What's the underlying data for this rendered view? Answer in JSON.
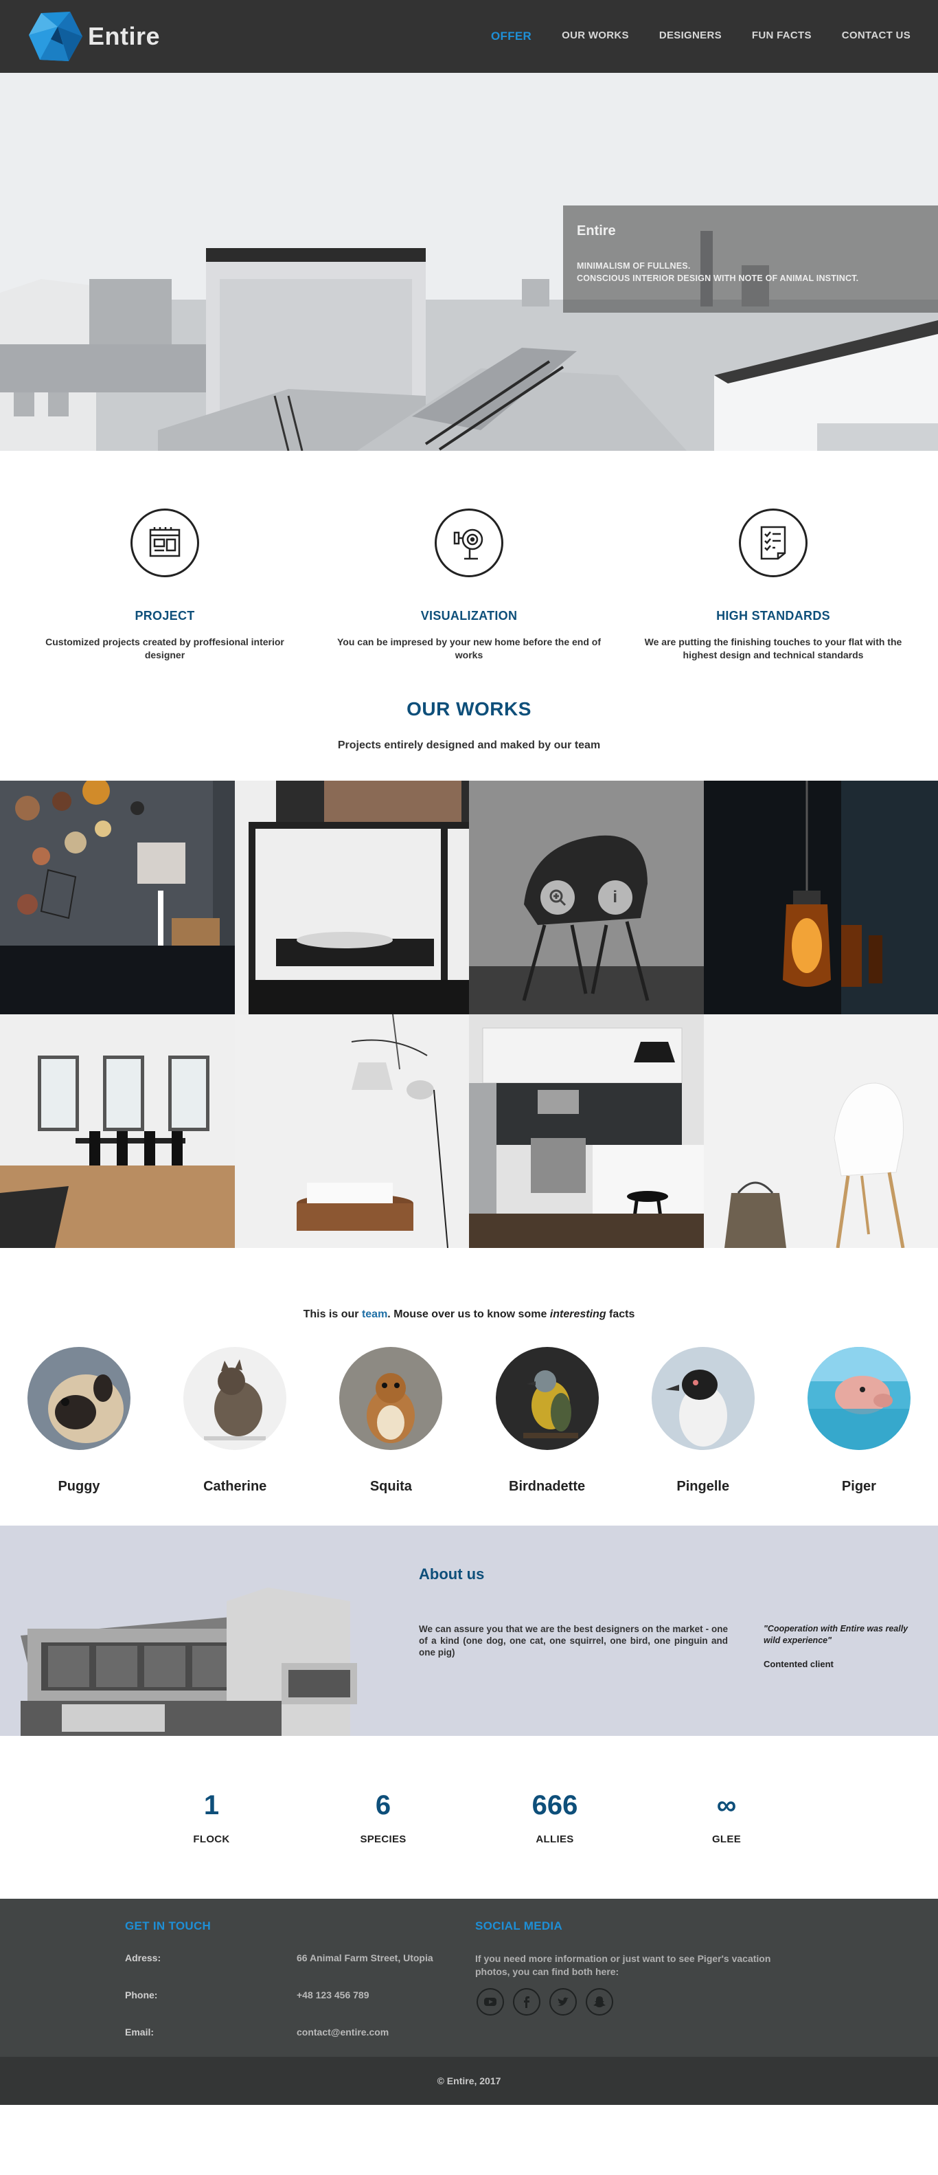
{
  "header": {
    "brand": "Entire",
    "nav": [
      {
        "label": "OFFER",
        "active": true
      },
      {
        "label": "OUR WORKS",
        "active": false
      },
      {
        "label": "DESIGNERS",
        "active": false
      },
      {
        "label": "FUN FACTS",
        "active": false
      },
      {
        "label": "CONTACT US",
        "active": false
      }
    ]
  },
  "hero": {
    "title": "Entire",
    "line1": "MINIMALISM OF FULLNES.",
    "line2": "CONSCIOUS INTERIOR DESIGN WITH NOTE OF ANIMAL INSTINCT."
  },
  "features": [
    {
      "icon": "blueprint-icon",
      "title": "PROJECT",
      "text": "Customized projects created by proffesional interior designer"
    },
    {
      "icon": "visualization-icon",
      "title": "VISUALIZATION",
      "text": "You can be impresed by your new home before the end of works"
    },
    {
      "icon": "checklist-icon",
      "title": "HIGH STANDARDS",
      "text": "We are putting the finishing touches to your flat with the highest design and technical standards"
    }
  ],
  "works": {
    "title": "OUR WORKS",
    "subtitle": "Projects entirely designed and maked by our team",
    "overlay_zoom_icon": "zoom-in-icon",
    "overlay_info_icon": "info-icon",
    "overlay_info_glyph": "i"
  },
  "team": {
    "intro_before": "This is our ",
    "intro_highlight": "team",
    "intro_middle": ". Mouse over us to know some ",
    "intro_italic": "interesting",
    "intro_after": " facts",
    "members": [
      "Puggy",
      "Catherine",
      "Squita",
      "Birdnadette",
      "Pingelle",
      "Piger"
    ]
  },
  "about": {
    "title": "About us",
    "text": "We can assure you that we are the best designers on the market - one of a kind (one dog, one cat, one squirrel, one bird, one pinguin and one pig)",
    "quote": "\"Cooperation with Entire was really wild experience\"",
    "quote_author": "Contented client"
  },
  "facts": [
    {
      "value": "1",
      "label": "FLOCK"
    },
    {
      "value": "6",
      "label": "SPECIES"
    },
    {
      "value": "666",
      "label": "ALLIES"
    },
    {
      "value": "∞",
      "label": "GLEE"
    }
  ],
  "footer": {
    "contact_heading": "GET IN TOUCH",
    "address_label": "Adress:",
    "address_value": "66 Animal Farm Street, Utopia",
    "phone_label": "Phone:",
    "phone_value": "+48 123 456 789",
    "email_label": "Email:",
    "email_value": "contact@entire.com",
    "social_heading": "SOCIAL MEDIA",
    "social_text": "If you need more information or just want to see Piger's vacation photos, you can find both here:",
    "social_icons": [
      "youtube-icon",
      "facebook-icon",
      "twitter-icon",
      "snapchat-icon"
    ],
    "copyright": "© Entire, 2017"
  },
  "colors": {
    "header_bg": "#333333",
    "accent_blue": "#1e8fd6",
    "heading_navy": "#0e4f7a",
    "about_bg": "#d3d6e1",
    "footer_bg": "#424545",
    "copyright_bg": "#343636"
  }
}
